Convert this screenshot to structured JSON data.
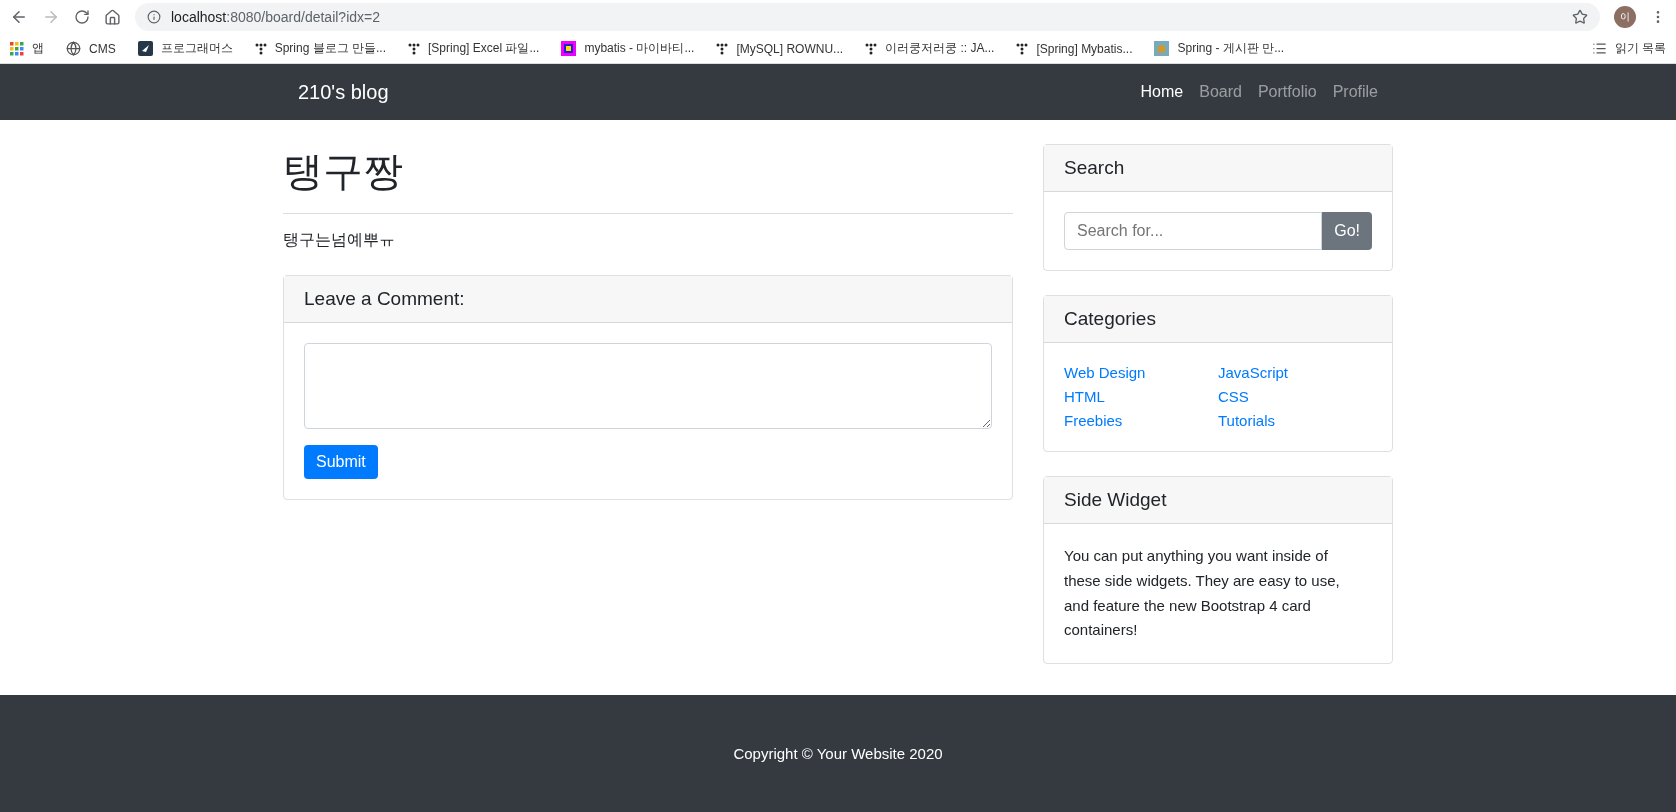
{
  "browser": {
    "url_host": "localhost",
    "url_rest": ":8080/board/detail?idx=2",
    "profile_initial": "이"
  },
  "bookmarks": [
    {
      "label": "앱",
      "kind": "apps"
    },
    {
      "label": "CMS",
      "kind": "globe"
    },
    {
      "label": "프로그래머스",
      "kind": "square"
    },
    {
      "label": "Spring 블로그 만들...",
      "kind": "dots"
    },
    {
      "label": "[Spring] Excel 파일...",
      "kind": "dots"
    },
    {
      "label": "mybatis - 마이바티...",
      "kind": "colorful"
    },
    {
      "label": "[MySQL] ROWNU...",
      "kind": "dots"
    },
    {
      "label": "이러쿵저러쿵 :: JA...",
      "kind": "dots"
    },
    {
      "label": "[Spring] Mybatis...",
      "kind": "dots"
    },
    {
      "label": "Spring - 게시판 만...",
      "kind": "image"
    }
  ],
  "reading_list": "읽기 목록",
  "navbar": {
    "brand": "210's blog",
    "items": [
      {
        "label": "Home",
        "selected": true
      },
      {
        "label": "Board",
        "selected": false
      },
      {
        "label": "Portfolio",
        "selected": false
      },
      {
        "label": "Profile",
        "selected": false
      }
    ]
  },
  "post": {
    "title": "탱구짱",
    "body": "탱구는넘예뿌ㅠ"
  },
  "comment": {
    "heading": "Leave a Comment:",
    "button": "Submit"
  },
  "sidebar": {
    "search": {
      "heading": "Search",
      "placeholder": "Search for...",
      "button": "Go!"
    },
    "categories": {
      "heading": "Categories",
      "columns": [
        [
          "Web Design",
          "HTML",
          "Freebies"
        ],
        [
          "JavaScript",
          "CSS",
          "Tutorials"
        ]
      ]
    },
    "widget": {
      "heading": "Side Widget",
      "text": "You can put anything you want inside of these side widgets. They are easy to use, and feature the new Bootstrap 4 card containers!"
    }
  },
  "footer": "Copyright © Your Website 2020"
}
